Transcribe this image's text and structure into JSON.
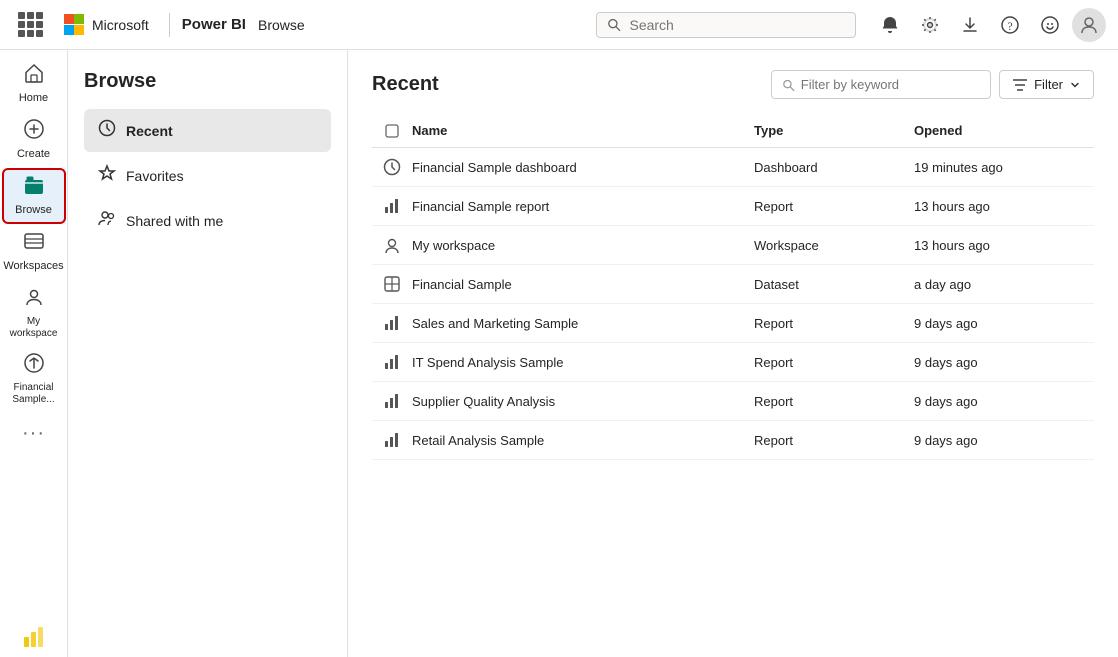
{
  "topnav": {
    "appname": "Power BI",
    "pagetitle": "Browse",
    "search_placeholder": "Search",
    "icons": {
      "bell": "🔔",
      "settings": "⚙",
      "download": "⬇",
      "help": "?",
      "smiley": "🙂"
    }
  },
  "sidebar": {
    "items": [
      {
        "id": "home",
        "label": "Home",
        "icon": "🏠"
      },
      {
        "id": "create",
        "label": "Create",
        "icon": "➕"
      },
      {
        "id": "browse",
        "label": "Browse",
        "icon": "📁",
        "active": true
      },
      {
        "id": "workspaces",
        "label": "Workspaces",
        "icon": "🖥"
      },
      {
        "id": "my-workspace",
        "label": "My workspace",
        "icon": "👤"
      },
      {
        "id": "financial-sample",
        "label": "Financial Sample...",
        "icon": "🕐"
      }
    ],
    "more_label": "···",
    "powerbi_label": "Power BI"
  },
  "browse_panel": {
    "title": "Browse",
    "menu": [
      {
        "id": "recent",
        "label": "Recent",
        "icon": "🕐",
        "active": true
      },
      {
        "id": "favorites",
        "label": "Favorites",
        "icon": "☆"
      },
      {
        "id": "shared-with-me",
        "label": "Shared with me",
        "icon": "👥"
      }
    ]
  },
  "main": {
    "title": "Recent",
    "filter_placeholder": "Filter by keyword",
    "filter_label": "Filter",
    "table": {
      "columns": [
        "",
        "Name",
        "Type",
        "Opened"
      ],
      "rows": [
        {
          "icon": "◔",
          "icon_type": "dashboard",
          "name": "Financial Sample dashboard",
          "type": "Dashboard",
          "opened": "19 minutes ago"
        },
        {
          "icon": "📊",
          "icon_type": "report",
          "name": "Financial Sample report",
          "type": "Report",
          "opened": "13 hours ago"
        },
        {
          "icon": "👤",
          "icon_type": "workspace",
          "name": "My workspace",
          "type": "Workspace",
          "opened": "13 hours ago"
        },
        {
          "icon": "⊞",
          "icon_type": "dataset",
          "name": "Financial Sample",
          "type": "Dataset",
          "opened": "a day ago"
        },
        {
          "icon": "📊",
          "icon_type": "report",
          "name": "Sales and Marketing Sample",
          "type": "Report",
          "opened": "9 days ago"
        },
        {
          "icon": "📊",
          "icon_type": "report",
          "name": "IT Spend Analysis Sample",
          "type": "Report",
          "opened": "9 days ago"
        },
        {
          "icon": "📊",
          "icon_type": "report",
          "name": "Supplier Quality Analysis",
          "type": "Report",
          "opened": "9 days ago"
        },
        {
          "icon": "📊",
          "icon_type": "report",
          "name": "Retail Analysis Sample",
          "type": "Report",
          "opened": "9 days ago"
        }
      ]
    }
  }
}
